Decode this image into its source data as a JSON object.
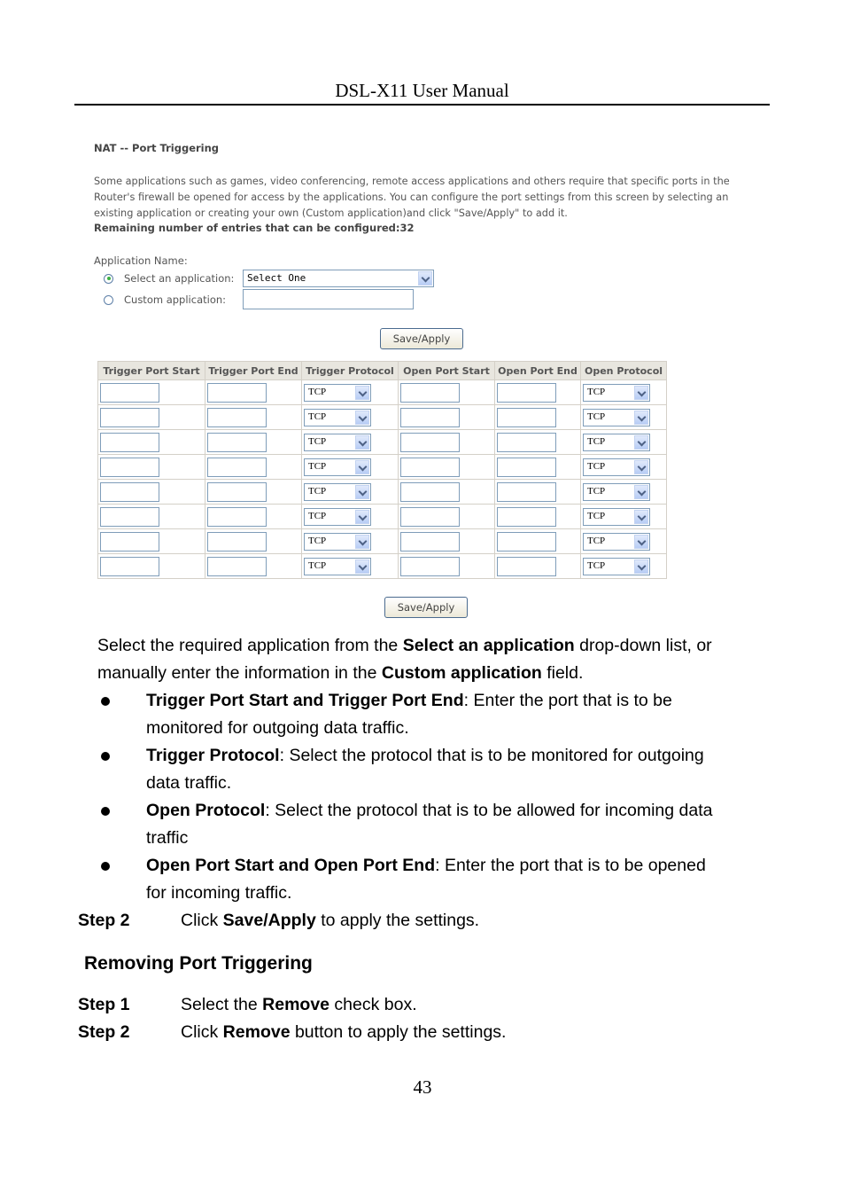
{
  "header": {
    "title": "DSL-X11 User Manual"
  },
  "screenshot": {
    "title": "NAT -- Port Triggering",
    "description": "Some applications such as games, video conferencing, remote access applications and others require that specific ports in the Router's firewall be opened for access by the applications. You can configure the port settings from this screen by selecting an existing application or creating your own (Custom application)and click \"Save/Apply\" to add it.",
    "remaining": "Remaining number of entries that can be configured:32",
    "app_name_label": "Application Name:",
    "select_app_label": "Select an application:",
    "select_app_value": "Select One",
    "custom_app_label": "Custom application:",
    "custom_app_value": "",
    "save_apply": "Save/Apply",
    "columns": [
      "Trigger Port Start",
      "Trigger Port End",
      "Trigger Protocol",
      "Open Port Start",
      "Open Port End",
      "Open Protocol"
    ],
    "rows": [
      {
        "trigger_start": "",
        "trigger_end": "",
        "trigger_protocol": "TCP",
        "open_start": "",
        "open_end": "",
        "open_protocol": "TCP"
      },
      {
        "trigger_start": "",
        "trigger_end": "",
        "trigger_protocol": "TCP",
        "open_start": "",
        "open_end": "",
        "open_protocol": "TCP"
      },
      {
        "trigger_start": "",
        "trigger_end": "",
        "trigger_protocol": "TCP",
        "open_start": "",
        "open_end": "",
        "open_protocol": "TCP"
      },
      {
        "trigger_start": "",
        "trigger_end": "",
        "trigger_protocol": "TCP",
        "open_start": "",
        "open_end": "",
        "open_protocol": "TCP"
      },
      {
        "trigger_start": "",
        "trigger_end": "",
        "trigger_protocol": "TCP",
        "open_start": "",
        "open_end": "",
        "open_protocol": "TCP"
      },
      {
        "trigger_start": "",
        "trigger_end": "",
        "trigger_protocol": "TCP",
        "open_start": "",
        "open_end": "",
        "open_protocol": "TCP"
      },
      {
        "trigger_start": "",
        "trigger_end": "",
        "trigger_protocol": "TCP",
        "open_start": "",
        "open_end": "",
        "open_protocol": "TCP"
      },
      {
        "trigger_start": "",
        "trigger_end": "",
        "trigger_protocol": "TCP",
        "open_start": "",
        "open_end": "",
        "open_protocol": "TCP"
      }
    ]
  },
  "body": {
    "intro": [
      {
        "t": "Select the required application from the ",
        "b": false
      },
      {
        "t": "Select an application",
        "b": true
      },
      {
        "t": " drop-down list, or",
        "b": false
      }
    ],
    "intro2": [
      {
        "t": "manually enter the information in the ",
        "b": false
      },
      {
        "t": "Custom application",
        "b": true
      },
      {
        "t": " field.",
        "b": false
      }
    ],
    "bullets": [
      {
        "bold": "Trigger Port Start and Trigger Port End",
        "line1": ": Enter the port that is to be",
        "line2": "monitored for outgoing data traffic."
      },
      {
        "bold": "Trigger Protocol",
        "line1": ": Select the protocol that is to be monitored for outgoing",
        "line2": "data traffic."
      },
      {
        "bold": "Open Protocol",
        "line1": ": Select the protocol that is to be allowed for incoming data",
        "line2": "traffic"
      },
      {
        "bold": "Open Port Start and Open Port End",
        "line1": ": Enter the port that is to be opened",
        "line2": "for incoming traffic."
      }
    ],
    "step2a": {
      "label": "Step 2",
      "pre": "Click ",
      "bold": "Save/Apply",
      "post": " to apply the settings."
    },
    "section_title": "Removing Port Triggering",
    "step1b": {
      "label": "Step 1",
      "pre": "Select the ",
      "bold": "Remove",
      "post": " check box."
    },
    "step2b": {
      "label": "Step 2",
      "pre": "Click ",
      "bold": "Remove",
      "post": " button to apply the settings."
    }
  },
  "footer": {
    "page_number": "43"
  }
}
